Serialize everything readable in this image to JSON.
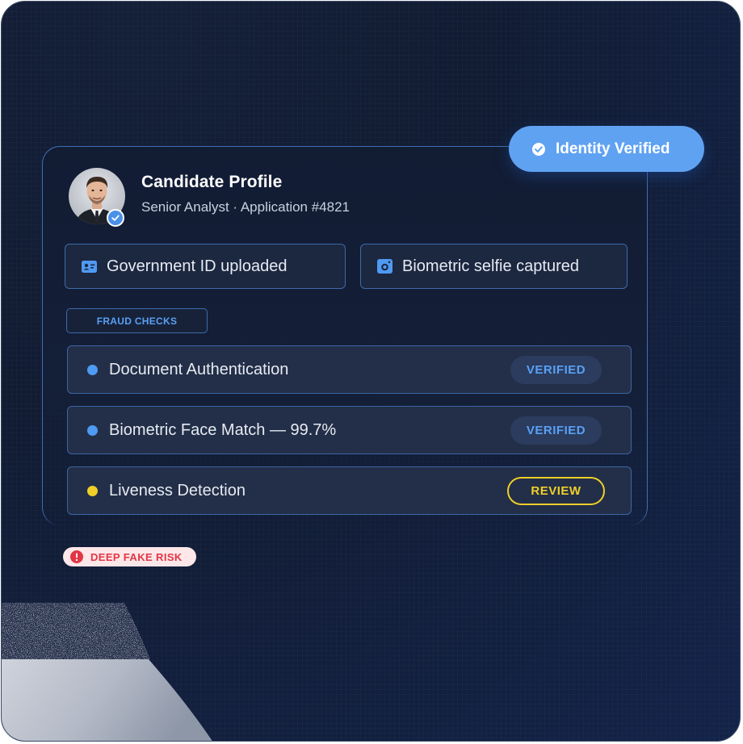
{
  "badge": {
    "label": "Identity Verified",
    "color": "#5fa2f2",
    "icon": "check-circle-icon"
  },
  "profile": {
    "title": "Candidate Profile",
    "subtitle": "Senior Analyst · Application #4821",
    "avatar_icon": "verified-badge-icon"
  },
  "documents": [
    {
      "label": "Government ID uploaded",
      "icon": "id-card-icon"
    },
    {
      "label": "Biometric selfie captured",
      "icon": "camera-icon"
    }
  ],
  "section_label": "FRAUD CHECKS",
  "checks": [
    {
      "label": "Document Authentication",
      "status": "VERIFIED",
      "dot_color": "#4f9af2"
    },
    {
      "label": "Biometric Face Match — 99.7%",
      "status": "VERIFIED",
      "dot_color": "#4f9af2"
    },
    {
      "label": "Liveness Detection",
      "status": "REVIEW",
      "dot_color": "#f0cf2a"
    }
  ],
  "risk": {
    "label": "DEEP FAKE RISK",
    "icon": "alert-circle-icon",
    "color": "#e23645"
  }
}
